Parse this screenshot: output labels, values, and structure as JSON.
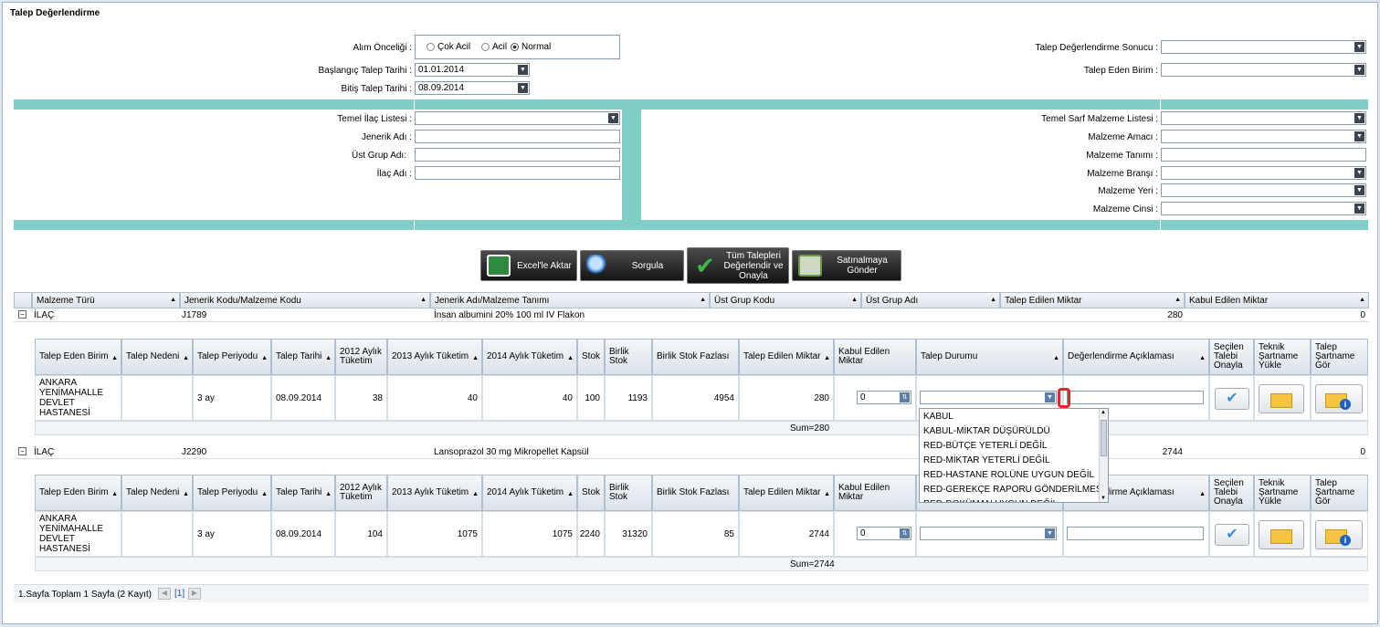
{
  "page": {
    "title": "Talep Değerlendirme"
  },
  "filters": {
    "alim_oncelik_label": "Alım Önceliği :",
    "oncelik_options": [
      "Çok Acil",
      "Acil",
      "Normal"
    ],
    "baslangic_label": "Başlangıç Talep Tarihi :",
    "baslangic_value": "01.01.2014",
    "bitis_label": "Bitiş Talep Tarihi :",
    "bitis_value": "08.09.2014",
    "sonuc_label": "Talep Değerlendirme Sonucu :",
    "eden_birim_label": "Talep Eden Birim :",
    "temel_ilac_label": "Temel İlaç Listesi :",
    "jenerik_label": "Jenerik Adı :",
    "ust_grup_label": "Üst Grup Adı:",
    "ilac_adi_label": "İlaç Adı :",
    "temel_sarf_label": "Temel Sarf Malzeme Listesi :",
    "malzeme_amaci_label": "Malzeme Amacı :",
    "malzeme_tanimi_label": "Malzeme Tanımı :",
    "malzeme_bransi_label": "Malzeme Branşı :",
    "malzeme_yeri_label": "Malzeme Yeri :",
    "malzeme_cinsi_label": "Malzeme Cinsi :"
  },
  "buttons": {
    "excel": "Excel'le Aktar",
    "sorgula": "Sorgula",
    "tum": "Tüm Talepleri Değerlendir ve Onayla",
    "satin": "Satınalmaya Gönder"
  },
  "grid": {
    "columns": [
      "Malzeme Türü",
      "Jenerik Kodu/Malzeme Kodu",
      "Jenerik Adı/Malzeme Tanımı",
      "Üst Grup Kodu",
      "Üst Grup Adı",
      "Talep Edilen Miktar",
      "Kabul Edilen Miktar"
    ],
    "detail_columns": [
      "Talep Eden Birim",
      "Talep Nedeni",
      "Talep Periyodu",
      "Talep Tarihi",
      "2012 Aylık Tüketim",
      "2013 Aylık Tüketim",
      "2014 Aylık Tüketim",
      "Stok",
      "Birlik Stok",
      "Birlik Stok Fazlası",
      "Talep Edilen Miktar",
      "Kabul Edilen Miktar",
      "Talep Durumu",
      "Değerlendirme Açıklaması",
      "Seçilen Talebi Onayla",
      "Teknik Şartname Yükle",
      "Talep Şartname Gör"
    ],
    "groups": [
      {
        "tur": "İLAÇ",
        "kod": "J1789",
        "ad": "İnsan albumini 20% 100 ml IV Flakon",
        "talep": "280",
        "kabul": "0",
        "row": {
          "birim": "ANKARA YENİMAHALLE DEVLET HASTANESİ",
          "nedeni": "",
          "periyot": "3 ay",
          "tarih": "08.09.2014",
          "t2012": "38",
          "t2013": "40",
          "t2014": "40",
          "stok": "100",
          "birlik": "1193",
          "fazla": "4954",
          "miktar": "280",
          "kabul": "0"
        },
        "sum": "Sum=280"
      },
      {
        "tur": "İLAÇ",
        "kod": "J2290",
        "ad": "Lansoprazol 30 mg Mikropellet Kapsül",
        "talep": "2744",
        "kabul": "0",
        "row": {
          "birim": "ANKARA YENİMAHALLE DEVLET HASTANESİ",
          "nedeni": "",
          "periyot": "3 ay",
          "tarih": "08.09.2014",
          "t2012": "104",
          "t2013": "1075",
          "t2014": "1075",
          "stok": "2240",
          "birlik": "31320",
          "fazla": "85",
          "miktar": "2744",
          "kabul": "0"
        },
        "sum": "Sum=2744"
      }
    ],
    "dropdown": [
      "KABUL",
      "KABUL-MİKTAR DÜŞÜRÜLDÜ",
      "RED-BÜTÇE YETERLİ DEĞİL",
      "RED-MİKTAR YETERLİ DEĞİL",
      "RED-HASTANE ROLÜNE UYGUN DEĞİL",
      "RED-GEREKÇE  RAPORU GÖNDERİLMESİ",
      "RED-DOKÜMAN UYGUN DEĞİL"
    ]
  },
  "pager": {
    "text": "1.Sayfa Toplam 1 Sayfa (2 Kayıt)",
    "page": "[1]"
  }
}
